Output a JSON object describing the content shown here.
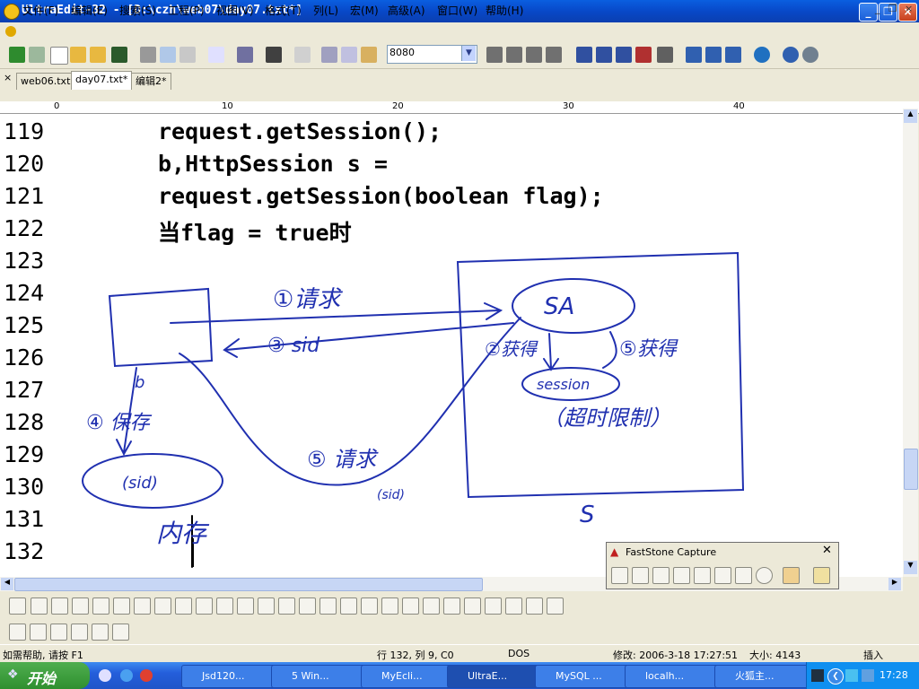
{
  "window": {
    "title": "UltraEdit-32 - [D:\\czh\\web07\\day07.txt*]"
  },
  "menu": [
    {
      "label": "文件(F)"
    },
    {
      "label": "编辑(E)"
    },
    {
      "label": "搜索(S)"
    },
    {
      "label": "工程(P)"
    },
    {
      "label": "视图(V)"
    },
    {
      "label": "格式(T)"
    },
    {
      "label": "列(L)"
    },
    {
      "label": "宏(M)"
    },
    {
      "label": "高级(A)"
    },
    {
      "label": "窗口(W)"
    },
    {
      "label": "帮助(H)"
    }
  ],
  "toolbar": {
    "combo_value": "8080"
  },
  "tabs": [
    {
      "label": "web06.txt"
    },
    {
      "label": "day07.txt*"
    },
    {
      "label": "编辑2*"
    }
  ],
  "ruler": [
    "0",
    "10",
    "20",
    "30",
    "40"
  ],
  "editor": {
    "lines": [
      {
        "num": "119",
        "text": "request.getSession();"
      },
      {
        "num": "120",
        "text": "b,HttpSession s ="
      },
      {
        "num": "121",
        "text": "request.getSession(boolean flag);"
      },
      {
        "num": "122",
        "text": "当flag = true时"
      },
      {
        "num": "123",
        "text": ""
      },
      {
        "num": "124",
        "text": ""
      },
      {
        "num": "125",
        "text": ""
      },
      {
        "num": "126",
        "text": ""
      },
      {
        "num": "127",
        "text": ""
      },
      {
        "num": "128",
        "text": ""
      },
      {
        "num": "129",
        "text": ""
      },
      {
        "num": "130",
        "text": ""
      },
      {
        "num": "131",
        "text": ""
      },
      {
        "num": "132",
        "text": ""
      }
    ]
  },
  "drawing": {
    "step1": "①请求",
    "step3": "③ sid",
    "step4": "④ 保存",
    "step5a": "⑤ 请求",
    "sid_small": "(sid)",
    "sid_oval": "(sid)",
    "memory": "内存",
    "b": "b",
    "sa": "SA",
    "step2": "②获得",
    "step5b": "⑤获得",
    "session": "session",
    "timeout": "（超时限制）",
    "server": "S"
  },
  "faststone": {
    "title": "FastStone Capture"
  },
  "status": {
    "help": "如需帮助, 请按 F1",
    "position": "行 132, 列 9, C0",
    "format": "DOS",
    "modified": "修改: 2006-3-18 17:27:51",
    "size": "大小: 4143",
    "mode": "插入"
  },
  "taskbar": {
    "start": "开始",
    "tasks": [
      {
        "label": "Jsd120..."
      },
      {
        "label": "5 Win..."
      },
      {
        "label": "MyEcli..."
      },
      {
        "label": "UltraE..."
      },
      {
        "label": "MySQL ..."
      },
      {
        "label": "localh..."
      },
      {
        "label": "火狐主..."
      }
    ],
    "clock": "17:28"
  }
}
